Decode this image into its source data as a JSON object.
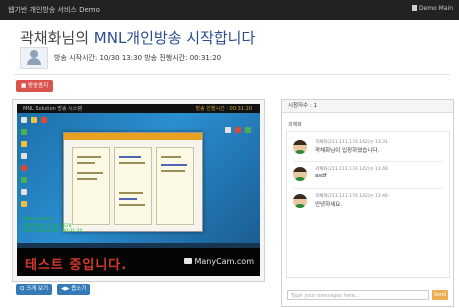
{
  "topbar": {
    "brand": "웹기반 개인방송 서비스 Demo",
    "user": "Demo Main"
  },
  "header": {
    "title_prefix": "곽채화님의 ",
    "title_highlight": "MNL개인방송 시작합니다",
    "meta_label": "방송 시작시간: 10/30 13:30 방송 진행시간: 00:31:20"
  },
  "actions": {
    "stop_button": "■ 방송종지"
  },
  "video": {
    "os_title": "MNL Solution 방송 시스템",
    "os_time": "방송 진행시간 : 00:31:20",
    "ticker_text": "테스트 중입니다.",
    "watermark": "ManyCam.com",
    "status_lines": [
      "MNL Solution",
      "곽채화 010-1234-5678",
      "010-1234-5678 / 00:31:20"
    ]
  },
  "controls": {
    "zoom_button": "Q 크게 보기",
    "hide_button": "◀▶ 좁소기"
  },
  "chat": {
    "header": "시청자수 : 1",
    "subheader": "곽채화",
    "messages": [
      {
        "meta": "곽채화(211.111.174.142)◷ 13:31",
        "text": "곽채화님이 입장하였습니다."
      },
      {
        "meta": "곽채화(211.111.174.142)◷ 13:46",
        "text": "asdf"
      },
      {
        "meta": "곽채화(211.111.174.142)◷ 13:46",
        "text": "안녕하세요."
      }
    ],
    "input_placeholder": "Type your messages here...",
    "send_label": "Send"
  }
}
